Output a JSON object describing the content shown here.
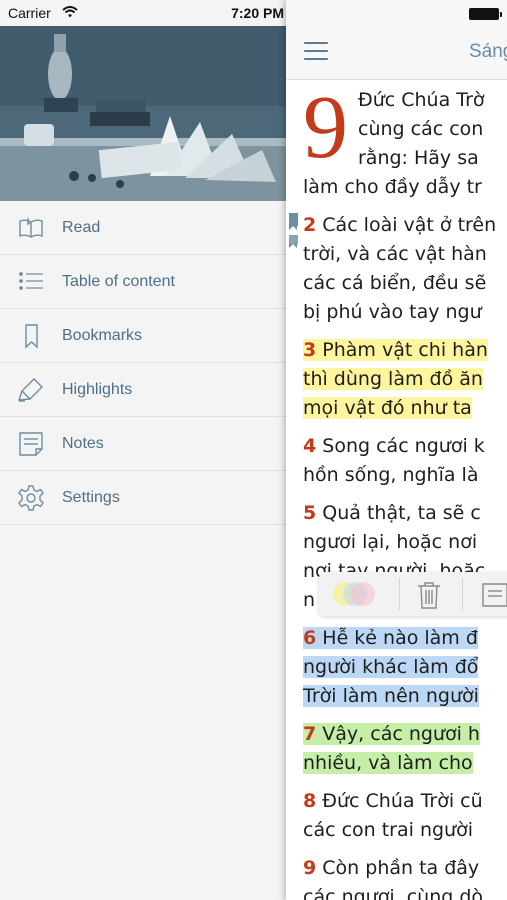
{
  "status_bar": {
    "carrier": "Carrier",
    "time": "7:20 PM"
  },
  "drawer": {
    "items": [
      {
        "label": "Read",
        "icon": "open-book-icon"
      },
      {
        "label": "Table of content",
        "icon": "list-icon"
      },
      {
        "label": "Bookmarks",
        "icon": "bookmark-icon"
      },
      {
        "label": "Highlights",
        "icon": "highlighter-icon"
      },
      {
        "label": "Notes",
        "icon": "note-icon"
      },
      {
        "label": "Settings",
        "icon": "gear-icon"
      }
    ]
  },
  "reader": {
    "title": "Sáng",
    "chapter_number": "9",
    "verse1_lines": [
      "Đức Chúa Trờ",
      "cùng các con",
      "rằng: Hãy sa",
      "làm cho đầy dẫy tr"
    ],
    "verses": [
      {
        "num": "2",
        "highlight": "none",
        "bookmarked": true,
        "lines": [
          "Các loài vật ở trên",
          "trời, và các vật hàn",
          "các cá biển, đều sẽ",
          "bị phú vào tay ngư"
        ]
      },
      {
        "num": "3",
        "highlight": "yellow",
        "bookmarked": false,
        "lines": [
          "Phàm vật chi hàn",
          "thì dùng làm đồ ăn",
          "mọi vật đó như ta"
        ]
      },
      {
        "num": "4",
        "highlight": "none",
        "bookmarked": false,
        "lines": [
          "Song các ngươi k",
          "hồn sống, nghĩa là"
        ]
      },
      {
        "num": "5",
        "highlight": "none",
        "bookmarked": false,
        "lines": [
          "Quả thật, ta sẽ c",
          "ngươi lại, hoặc nơi",
          "nơi tay người, hoặc",
          "n"
        ]
      },
      {
        "num": "6",
        "highlight": "blue",
        "bookmarked": false,
        "lines": [
          "Hễ kẻ nào làm đ",
          "người khác làm đổ",
          "Trời làm nên người"
        ]
      },
      {
        "num": "7",
        "highlight": "green",
        "bookmarked": false,
        "lines": [
          "Vậy, các ngươi h",
          "nhiều, và làm cho"
        ]
      },
      {
        "num": "8",
        "highlight": "none",
        "bookmarked": false,
        "lines": [
          "Đức Chúa Trời cũ",
          "các con trai người"
        ]
      },
      {
        "num": "9",
        "highlight": "none",
        "bookmarked": false,
        "lines": [
          "Còn phần ta đây",
          "các ngươi, cùng dò"
        ]
      }
    ],
    "highlight_colors": {
      "yellow": "#fff59d",
      "blue": "#bcd8f6",
      "green": "#c5efa6",
      "verse_number": "#c23b1b"
    },
    "popup_actions": [
      "color-picker-icon",
      "trash-icon",
      "note-icon"
    ]
  }
}
